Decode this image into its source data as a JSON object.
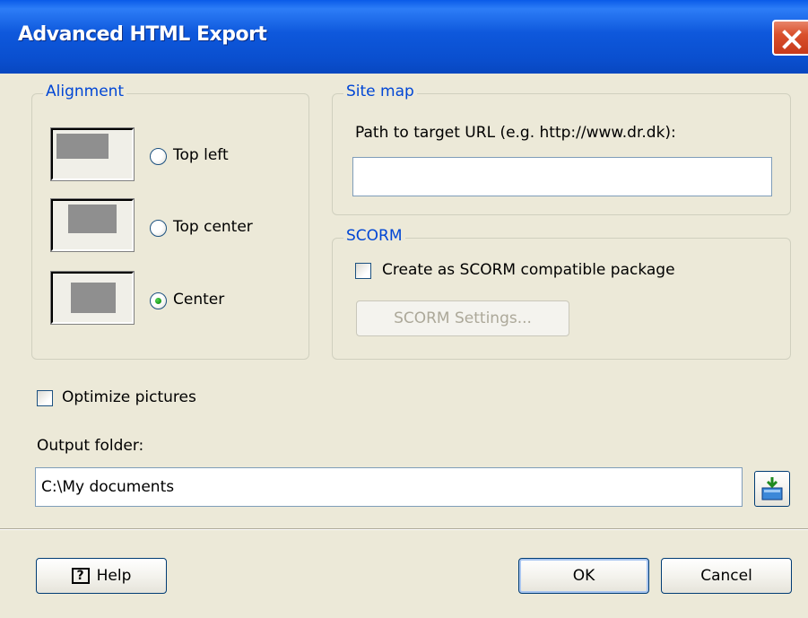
{
  "window": {
    "title": "Advanced HTML Export"
  },
  "alignment": {
    "legend": "Alignment",
    "options": [
      {
        "label": "Top left",
        "selected": false
      },
      {
        "label": "Top center",
        "selected": false
      },
      {
        "label": "Center",
        "selected": true
      }
    ]
  },
  "site_map": {
    "legend": "Site map",
    "path_label": "Path to target URL (e.g. http://www.dr.dk):",
    "path_value": ""
  },
  "scorm": {
    "legend": "SCORM",
    "create_label": "Create as SCORM compatible package",
    "create_checked": false,
    "settings_button": "SCORM Settings...",
    "settings_enabled": false
  },
  "optimize": {
    "label": "Optimize pictures",
    "checked": false
  },
  "output": {
    "label": "Output folder:",
    "value": "C:\\My documents",
    "browse_icon": "folder-browse-icon"
  },
  "buttons": {
    "help": "Help",
    "ok": "OK",
    "cancel": "Cancel"
  },
  "colors": {
    "title_bar": "#0a4fcf",
    "legend_text": "#0046d5",
    "dialog_bg": "#ece9d8",
    "close_button": "#d9502c",
    "radio_selected": "#21a121"
  }
}
